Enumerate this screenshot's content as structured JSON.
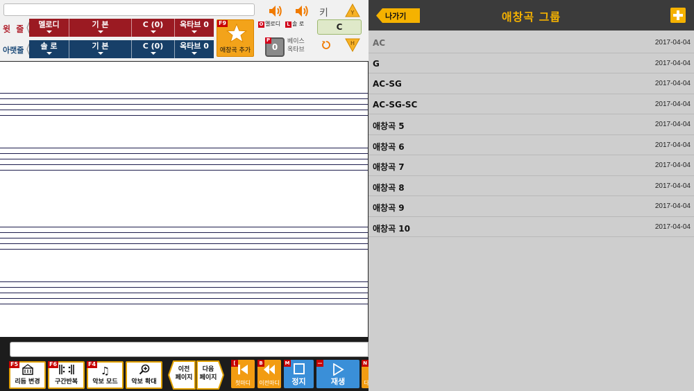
{
  "top": {
    "upper_label": "윗 줄",
    "lower_label": "아랫줄",
    "upper": {
      "melody": "멜로디",
      "style": "기 본",
      "key": "C (0)",
      "octave": "옥타브 0"
    },
    "lower": {
      "melody": "솔 로",
      "style": "기 본",
      "key": "C (0)",
      "octave": "옥타브 0"
    },
    "fav_add": {
      "badge": "F9",
      "label": "애창곡 추가"
    },
    "vol_melody": {
      "badge": "O",
      "label": "멜로디"
    },
    "vol_solo": {
      "badge": "L",
      "label": "솔 로"
    },
    "bass": {
      "badge": "P",
      "value": "0",
      "label": "베이스 옥타브"
    },
    "key": {
      "label": "키",
      "value": "C",
      "up": "Y",
      "down": "H"
    }
  },
  "bottom": {
    "tools": [
      {
        "badge": "F5",
        "label": "리듬 변경"
      },
      {
        "badge": "F6",
        "label": "구간반복"
      },
      {
        "badge": "F4",
        "label": "악보 모드"
      },
      {
        "badge": "",
        "label": "악보 확대"
      }
    ],
    "prev_page": "이전\n페이지",
    "next_page": "다음\n페이지",
    "play": [
      {
        "badge": "[",
        "label": "첫마디"
      },
      {
        "badge": "B",
        "label": "이전마디"
      },
      {
        "badge": "M",
        "label": "정지"
      },
      {
        "badge": "—",
        "label": "재생"
      },
      {
        "badge": "N",
        "label": "다"
      }
    ]
  },
  "panel": {
    "back": "나가기",
    "title": "애창곡 그룹",
    "groups": [
      {
        "name": "AC",
        "date": "2017-04-04"
      },
      {
        "name": "G",
        "date": "2017-04-04"
      },
      {
        "name": "AC-SG",
        "date": "2017-04-04"
      },
      {
        "name": "AC-SG-SC",
        "date": "2017-04-04"
      },
      {
        "name": "애창곡 5",
        "date": "2017-04-04"
      },
      {
        "name": "애창곡 6",
        "date": "2017-04-04"
      },
      {
        "name": "애창곡 7",
        "date": "2017-04-04"
      },
      {
        "name": "애창곡 8",
        "date": "2017-04-04"
      },
      {
        "name": "애창곡 9",
        "date": "2017-04-04"
      },
      {
        "name": "애창곡 10",
        "date": "2017-04-04"
      }
    ]
  },
  "colors": {
    "accent": "#f5b200",
    "upper": "#9b1a22",
    "lower": "#173f68",
    "panel": "#cecece",
    "header": "#3b3b3b"
  }
}
